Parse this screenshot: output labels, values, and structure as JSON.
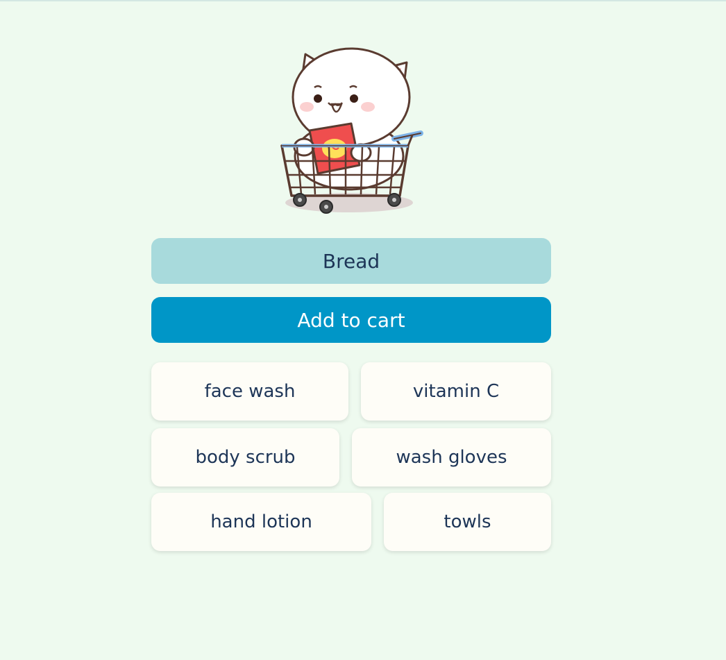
{
  "input": {
    "value": "Bread"
  },
  "add_button": {
    "label": "Add to cart"
  },
  "items": [
    {
      "label": "face wash"
    },
    {
      "label": "vitamin C"
    },
    {
      "label": "body scrub"
    },
    {
      "label": "wash gloves"
    },
    {
      "label": "hand lotion"
    },
    {
      "label": "towls"
    }
  ],
  "colors": {
    "background": "#eefaef",
    "input_bg": "#a8dadc",
    "button_bg": "#0096c7",
    "item_bg": "#fefdf7",
    "text": "#1d3557"
  },
  "icons": {
    "illustration": "cat-in-shopping-cart-icon"
  }
}
